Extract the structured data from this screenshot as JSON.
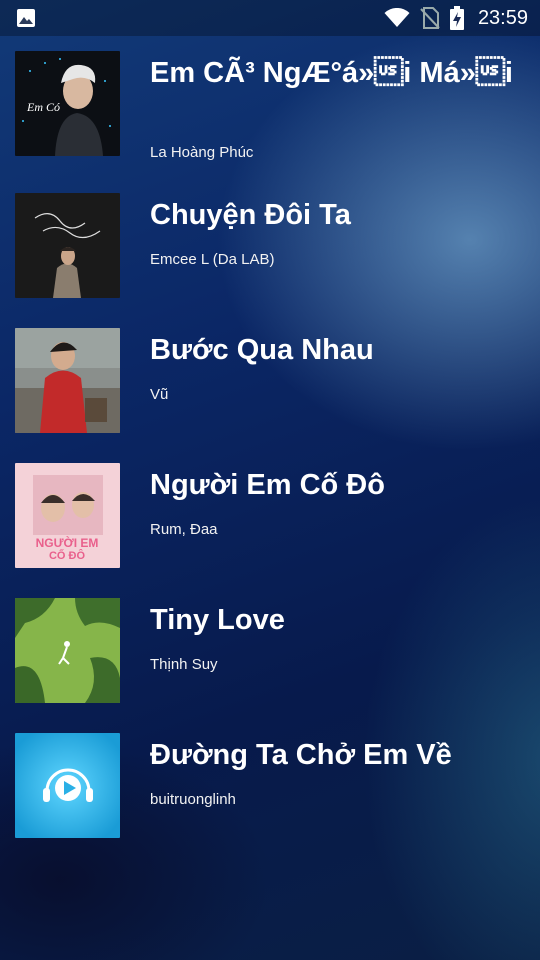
{
  "status_bar": {
    "time": "23:59",
    "icons": [
      "image-icon",
      "wifi-icon",
      "no-sim-icon",
      "battery-charging-icon"
    ]
  },
  "songs": [
    {
      "title": "Em CÃ³ NgÆ°á»\u001fi Má»\u001fi",
      "artist": "La Hoàng Phúc",
      "cover_icon": "album-cover-em-co-nguoi-moi"
    },
    {
      "title": "Chuyện Đôi Ta",
      "artist": "Emcee L (Da LAB)",
      "cover_icon": "album-cover-chuyen-doi-ta"
    },
    {
      "title": "Bước Qua Nhau",
      "artist": "Vũ",
      "cover_icon": "album-cover-buoc-qua-nhau"
    },
    {
      "title": "Người Em Cố Đô",
      "artist": "Rum, Đaa",
      "cover_icon": "album-cover-nguoi-em-co-do"
    },
    {
      "title": "Tiny Love",
      "artist": "Thịnh Suy",
      "cover_icon": "album-cover-tiny-love"
    },
    {
      "title": "Đường Ta Chở Em Về",
      "artist": "buitruonglinh",
      "cover_icon": "album-cover-duong-ta-cho-em-ve"
    }
  ]
}
